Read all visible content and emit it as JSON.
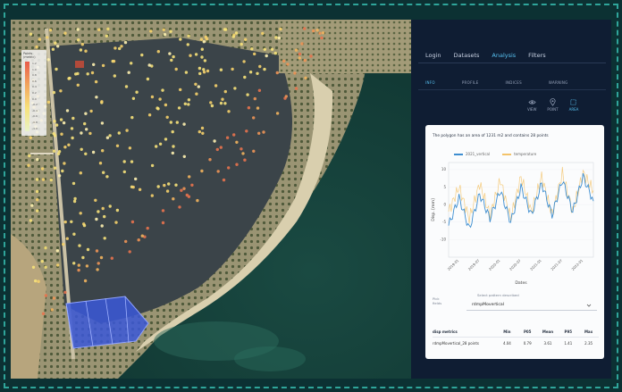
{
  "map": {
    "legend_title_line1": "Points",
    "legend_title_line2": "(metric)",
    "legend_ticks": [
      "1.2",
      "1.0",
      "0.8",
      "0.6",
      "0.4",
      "0.2",
      "0.0",
      "-0.2",
      "-0.4",
      "-0.6",
      "-0.8",
      "-1.0"
    ]
  },
  "nav": {
    "tabs": [
      {
        "label": "Login"
      },
      {
        "label": "Datasets"
      },
      {
        "label": "Analysis"
      },
      {
        "label": "Filters"
      }
    ],
    "active_tab": 2
  },
  "subtabs": [
    {
      "label": "INFO"
    },
    {
      "label": "PROFILE"
    },
    {
      "label": "INDICES"
    },
    {
      "label": "WARNING"
    }
  ],
  "modes": [
    {
      "label": "VIEW",
      "icon": "eye-icon"
    },
    {
      "label": "POINT",
      "icon": "pin-icon"
    },
    {
      "label": "AREA",
      "icon": "polygon-icon"
    }
  ],
  "card": {
    "title": "The polygon has an area of 1231 m2 and contains 28 points",
    "select_hint": "Select pattern described",
    "select_label_line1": "Pick",
    "select_label_line2": "fields",
    "select_value": "rdmpMovertical"
  },
  "chart_data": {
    "type": "line",
    "title": "",
    "xlabel": "Dates",
    "ylabel": "Disp. [mm]",
    "ylim": [
      -15,
      12
    ],
    "y_ticks": [
      10,
      5,
      0,
      -5,
      -10
    ],
    "x_ticks": [
      "2019-01",
      "2019-07",
      "2020-01",
      "2020-07",
      "2021-01",
      "2021-07",
      "2022-01"
    ],
    "x": [
      "2018-10",
      "2019-01",
      "2019-04",
      "2019-07",
      "2019-10",
      "2020-01",
      "2020-04",
      "2020-07",
      "2020-10",
      "2021-01",
      "2021-04",
      "2021-07",
      "2021-10",
      "2022-01",
      "2022-04"
    ],
    "series": [
      {
        "name": "2021_vertical",
        "color": "#3e8ed0",
        "values": [
          -6,
          2,
          -7,
          3,
          -4,
          4,
          -5,
          5,
          -3,
          6,
          -3,
          7,
          -2,
          8,
          1
        ]
      },
      {
        "name": "temperature",
        "color": "#f3c36a",
        "values": [
          -2,
          5,
          -4,
          6,
          -3,
          7,
          -4,
          8,
          -2,
          8,
          -3,
          9,
          -2,
          9,
          4
        ]
      }
    ]
  },
  "table": {
    "headers": [
      "disp metrics",
      "Min",
      "P05",
      "Mean",
      "P95",
      "Max"
    ],
    "rows": [
      [
        "rdmpMovertical_28 points",
        "4.04",
        "0.79",
        "3.61",
        "1.41",
        "2.35"
      ]
    ]
  }
}
